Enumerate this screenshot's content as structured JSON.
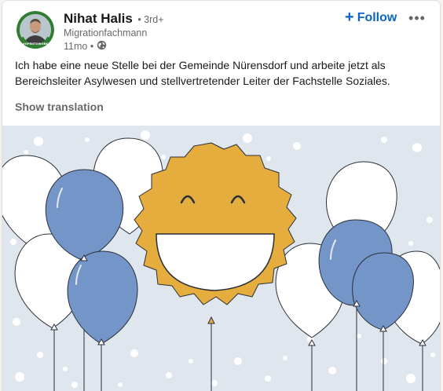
{
  "post": {
    "author": {
      "name": "Nihat Halis",
      "degree": "• 3rd+",
      "headline": "Migrationfachmann",
      "time": "11mo •",
      "avatar_badge": "#OPENTOWORK",
      "avatar_ring_color": "#2e7d32"
    },
    "follow_label": "Follow",
    "more_icon": "ellipsis-icon",
    "text": "Ich habe eine neue Stelle bei der Gemeinde Nürensdorf und arbeite jetzt als Bereichsleiter Asylwesen und stellvertretender Leiter der Fachstelle Soziales.",
    "translation_label": "Show translation",
    "image": {
      "description_icon": "smiley-sun-balloons-illustration",
      "colors": {
        "background": "#dfe6ee",
        "sun": "#e5ad3e",
        "balloon_blue": "#7395c8",
        "balloon_white": "#ffffff"
      }
    }
  }
}
